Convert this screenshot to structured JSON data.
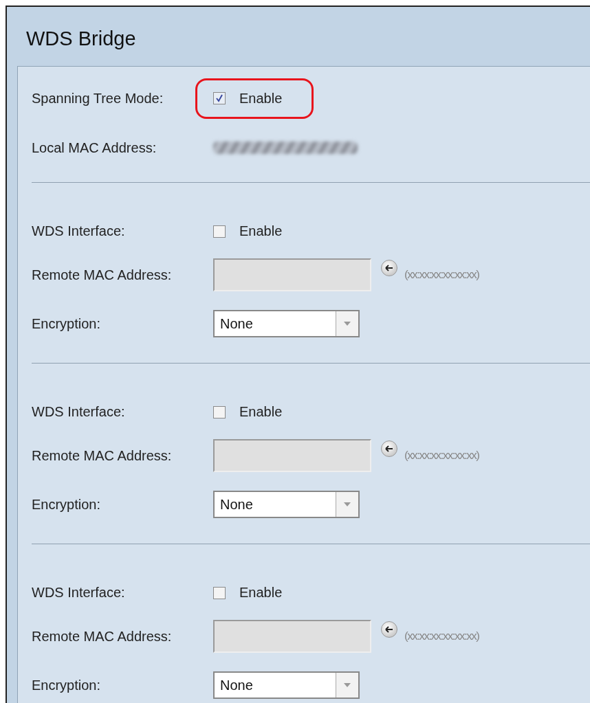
{
  "title": "WDS Bridge",
  "spanning_tree": {
    "label": "Spanning Tree Mode:",
    "checked": true,
    "option": "Enable",
    "highlighted": true
  },
  "local_mac": {
    "label": "Local MAC Address:"
  },
  "interfaces": [
    {
      "label": "WDS Interface:",
      "checked": false,
      "option": "Enable",
      "remote_label": "Remote MAC Address:",
      "disabled": true,
      "hint": "(xx:xx:xx:xx:xx:xx)",
      "encryption_label": "Encryption:",
      "encryption": "None"
    },
    {
      "label": "WDS Interface:",
      "checked": false,
      "option": "Enable",
      "remote_label": "Remote MAC Address:",
      "disabled": true,
      "hint": "(xx:xx:xx:xx:xx:xx)",
      "encryption_label": "Encryption:",
      "encryption": "None"
    },
    {
      "label": "WDS Interface:",
      "checked": false,
      "option": "Enable",
      "remote_label": "Remote MAC Address:",
      "disabled": true,
      "hint": "(xx:xx:xx:xx:xx:xx)",
      "encryption_label": "Encryption:",
      "encryption": "None"
    }
  ]
}
